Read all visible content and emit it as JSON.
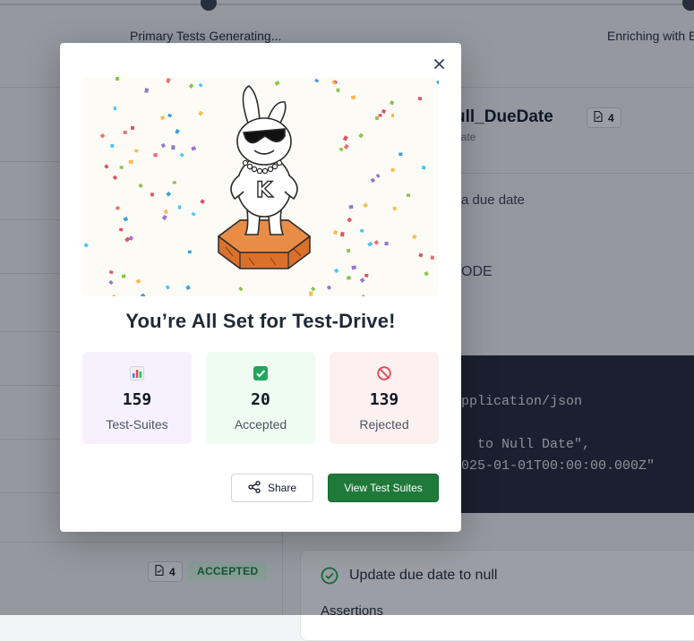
{
  "background": {
    "steps": [
      {
        "label": "Primary Tests Generating..."
      },
      {
        "label": "Enriching with E"
      }
    ],
    "header": {
      "title_fragment": "ull_DueDate",
      "subtitle_fragment": "date",
      "badge_count": "4"
    },
    "description_fragment": "a due date",
    "section_fragment": "ODE",
    "code_lines": [
      "pplication/json",
      "  to Null Date\",",
      "025-01-01T00:00:00.000Z\""
    ],
    "list_row": {
      "badge_count": "4",
      "status": "ACCEPTED"
    },
    "assertion_title": "Update due date to null",
    "assertions_label": "Assertions"
  },
  "modal": {
    "title": "You’re All Set for Test-Drive!",
    "mascot_letter": "K",
    "stats": [
      {
        "icon": "bar-chart-icon",
        "value": "159",
        "label": "Test-Suites"
      },
      {
        "icon": "check-box-icon",
        "value": "20",
        "label": "Accepted"
      },
      {
        "icon": "prohibited-icon",
        "value": "139",
        "label": "Rejected"
      }
    ],
    "share_label": "Share",
    "view_label": "View Test Suites"
  },
  "colors": {
    "primary_button": "#1f7a3a",
    "accepted": "#15803d",
    "rejected": "#dc2626"
  }
}
